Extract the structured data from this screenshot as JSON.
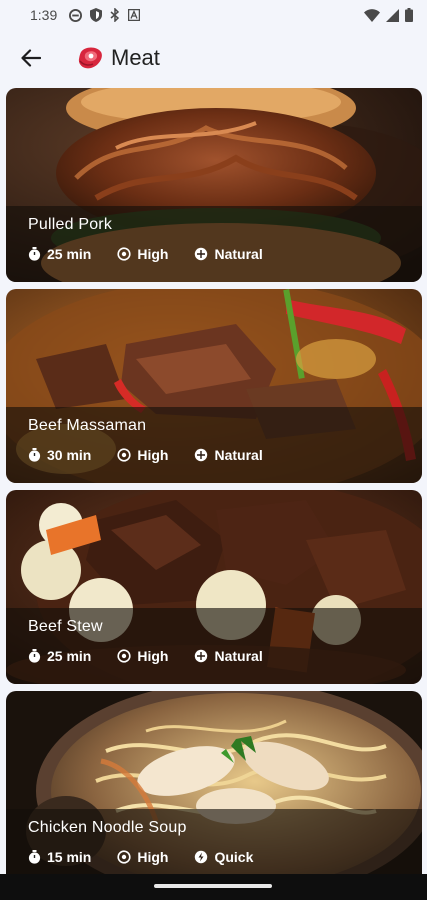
{
  "status_bar": {
    "time": "1:39",
    "icons_left": [
      "do-not-disturb-icon",
      "shield-icon",
      "bluetooth-icon",
      "a-icon"
    ],
    "icons_right": [
      "wifi-icon",
      "signal-icon",
      "battery-icon"
    ]
  },
  "app_bar": {
    "title": "Meat",
    "back_icon": "arrow-left-icon",
    "category_icon": "steak-icon"
  },
  "recipes": [
    {
      "title": "Pulled Pork",
      "time": "25 min",
      "difficulty": "High",
      "tag": "Natural",
      "tag_icon": "sun-icon"
    },
    {
      "title": "Beef Massaman",
      "time": "30 min",
      "difficulty": "High",
      "tag": "Natural",
      "tag_icon": "sun-icon"
    },
    {
      "title": "Beef Stew",
      "time": "25 min",
      "difficulty": "High",
      "tag": "Natural",
      "tag_icon": "sun-icon"
    },
    {
      "title": "Chicken Noodle Soup",
      "time": "15 min",
      "difficulty": "High",
      "tag": "Quick",
      "tag_icon": "bolt-icon"
    }
  ],
  "colors": {
    "background": "#f3f5fb",
    "accent": "#d7263d",
    "overlay": "#140e0a"
  }
}
